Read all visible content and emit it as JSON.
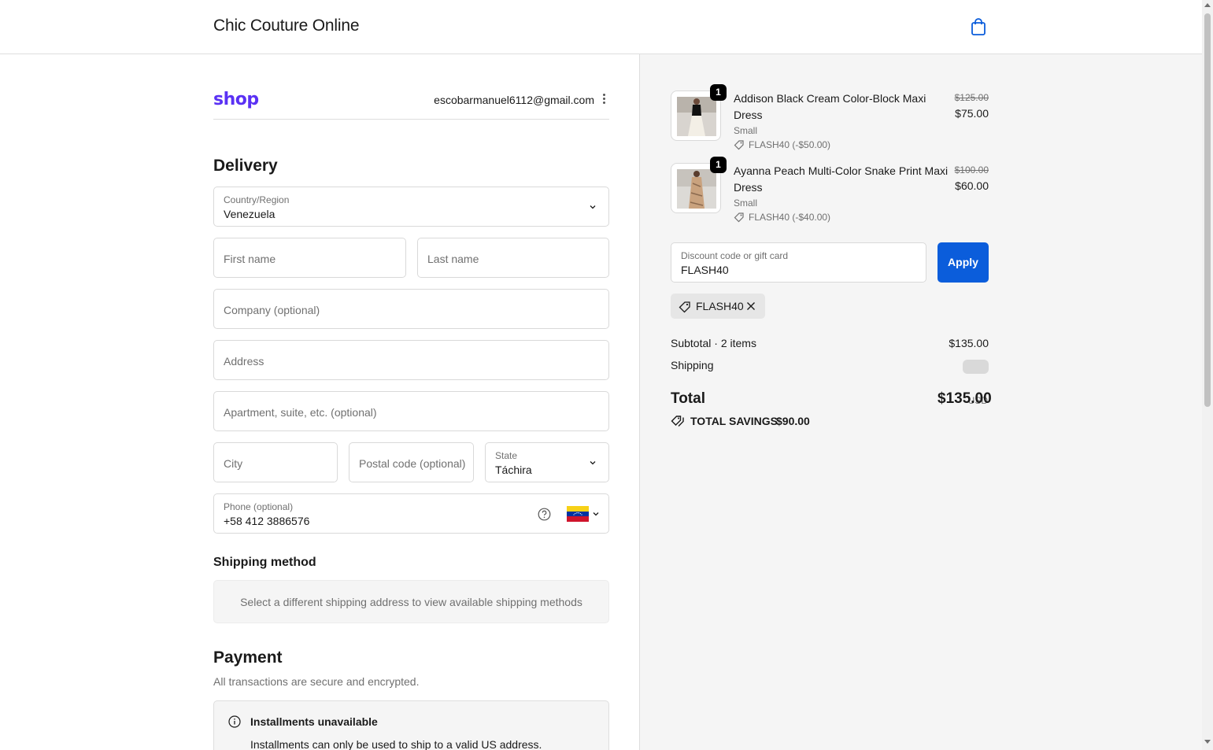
{
  "header": {
    "store_name": "Chic Couture Online",
    "cart_icon": "shopping-bag-icon"
  },
  "account": {
    "logo": "shop",
    "email": "escobarmanuel6112@gmail.com",
    "menu_icon": "kebab-menu-icon"
  },
  "delivery": {
    "title": "Delivery",
    "country": {
      "label": "Country/Region",
      "value": "Venezuela"
    },
    "first_name": {
      "placeholder": "First name"
    },
    "last_name": {
      "placeholder": "Last name"
    },
    "company": {
      "placeholder": "Company (optional)"
    },
    "address": {
      "placeholder": "Address"
    },
    "apartment": {
      "placeholder": "Apartment, suite, etc. (optional)"
    },
    "city": {
      "placeholder": "City"
    },
    "postal": {
      "placeholder": "Postal code (optional)"
    },
    "state": {
      "label": "State",
      "value": "Táchira"
    },
    "phone": {
      "label": "Phone (optional)",
      "value": "+58 412 3886576",
      "help_icon": "question-circle-icon",
      "flag_icon": "venezuela-flag-icon"
    }
  },
  "shipping_method": {
    "title": "Shipping method",
    "message": "Select a different shipping address to view available shipping methods"
  },
  "payment": {
    "title": "Payment",
    "subtitle": "All transactions are secure and encrypted.",
    "notice_title": "Installments unavailable",
    "notice_text": "Installments can only be used to ship to a valid US address."
  },
  "order": {
    "items": [
      {
        "qty": "1",
        "name": "Addison Black Cream Color-Block Maxi Dress",
        "variant": "Small",
        "discount": "FLASH40 (-$50.00)",
        "original_price": "$125.00",
        "price": "$75.00"
      },
      {
        "qty": "1",
        "name": "Ayanna Peach Multi-Color Snake Print Maxi Dress",
        "variant": "Small",
        "discount": "FLASH40 (-$40.00)",
        "original_price": "$100.00",
        "price": "$60.00"
      }
    ],
    "discount_field": {
      "label": "Discount code or gift card",
      "value": "FLASH40"
    },
    "apply_label": "Apply",
    "applied_code": "FLASH40",
    "subtotal_label": "Subtotal · 2 items",
    "subtotal_value": "$135.00",
    "shipping_label": "Shipping",
    "total_label": "Total",
    "currency": "USD",
    "total_value": "$135.00",
    "savings_label": "TOTAL SAVINGS",
    "savings_value": "$90.00"
  },
  "colors": {
    "accent": "#0b5ddb",
    "shop_brand": "#5a31f4",
    "summary_bg": "#f5f5f5"
  }
}
